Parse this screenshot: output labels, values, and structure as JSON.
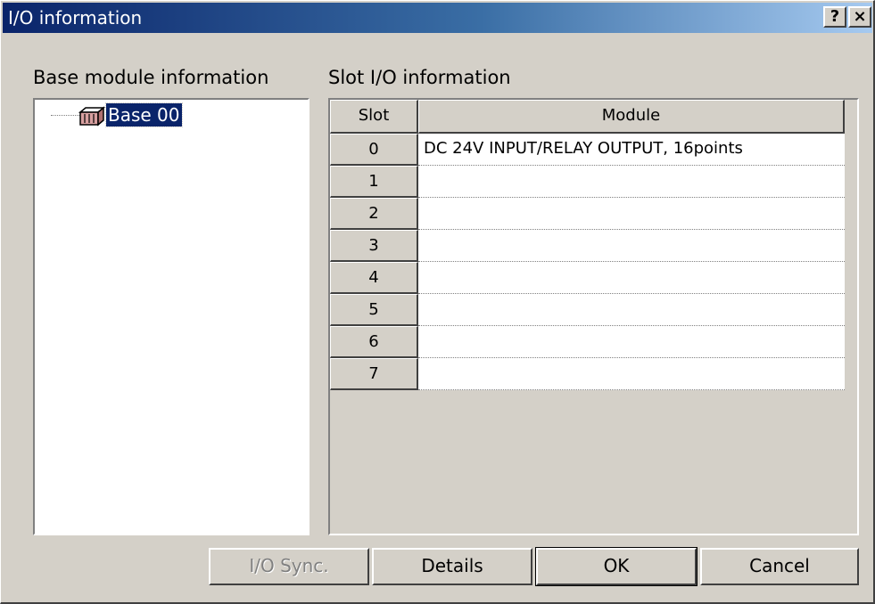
{
  "window": {
    "title": "I/O information",
    "help_button": "?",
    "close_button": "×"
  },
  "left_panel": {
    "label": "Base module information",
    "tree": [
      {
        "label": "Base 00",
        "icon": "base-module-icon",
        "selected": true
      }
    ]
  },
  "right_panel": {
    "label": "Slot I/O information",
    "columns": [
      "Slot",
      "Module"
    ],
    "rows": [
      {
        "slot": "0",
        "module": "DC 24V INPUT/RELAY OUTPUT, 16points"
      },
      {
        "slot": "1",
        "module": ""
      },
      {
        "slot": "2",
        "module": ""
      },
      {
        "slot": "3",
        "module": ""
      },
      {
        "slot": "4",
        "module": ""
      },
      {
        "slot": "5",
        "module": ""
      },
      {
        "slot": "6",
        "module": ""
      },
      {
        "slot": "7",
        "module": ""
      }
    ]
  },
  "buttons": {
    "io_sync": "I/O Sync.",
    "details": "Details",
    "ok": "OK",
    "cancel": "Cancel"
  },
  "colors": {
    "selection": "#0a246a",
    "face": "#d4d0c8"
  }
}
